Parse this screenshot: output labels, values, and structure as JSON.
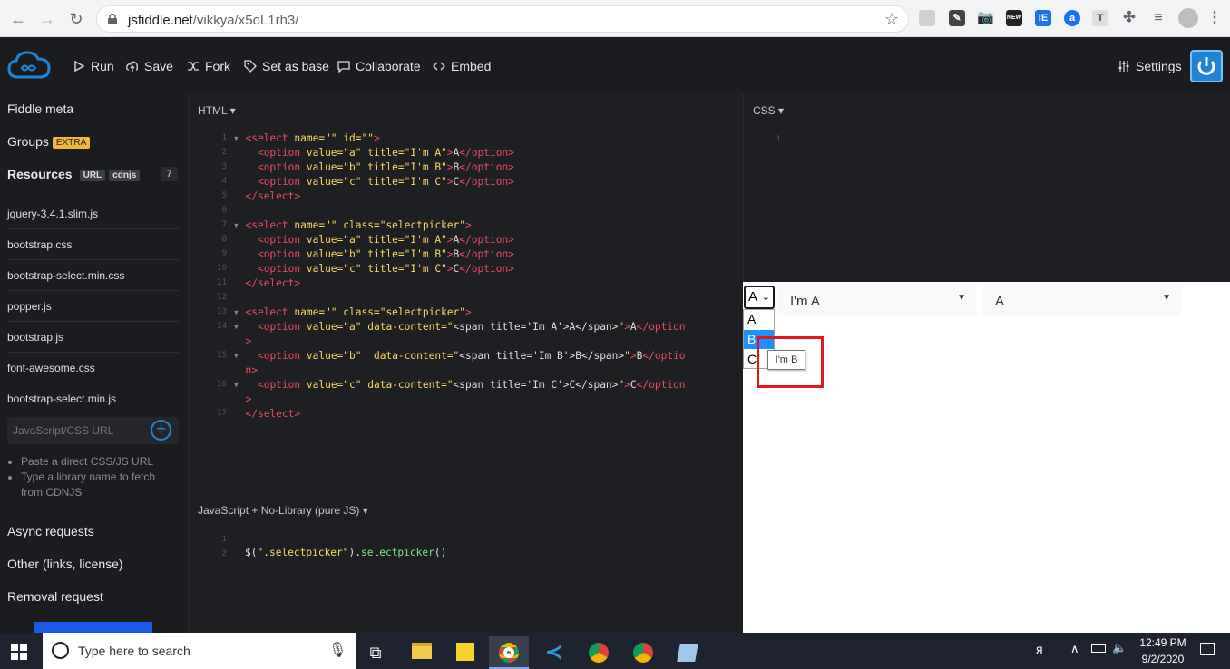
{
  "browser": {
    "url_host": "jsfiddle.net",
    "url_path": "/vikkya/x5oL1rh3/"
  },
  "header": {
    "run": "Run",
    "save": "Save",
    "fork": "Fork",
    "set_as_base": "Set as base",
    "collaborate": "Collaborate",
    "embed": "Embed",
    "settings": "Settings"
  },
  "sidebar": {
    "fiddle_meta": "Fiddle meta",
    "groups": "Groups",
    "groups_badge": "EXTRA",
    "resources": "Resources",
    "resources_url_tag": "URL",
    "resources_cdnjs_tag": "cdnjs",
    "resources_count": "7",
    "resources_list": [
      "jquery-3.4.1.slim.js",
      "bootstrap.css",
      "bootstrap-select.min.css",
      "popper.js",
      "bootstrap.js",
      "font-awesome.css",
      "bootstrap-select.min.js"
    ],
    "url_placeholder": "JavaScript/CSS URL",
    "hint1": "Paste a direct CSS/JS URL",
    "hint2": "Type a library name to fetch from CDNJS",
    "async": "Async requests",
    "other": "Other (links, license)",
    "removal": "Removal request"
  },
  "panels": {
    "html_label": "HTML",
    "css_label": "CSS",
    "js_label": "JavaScript + No-Library (pure JS)"
  },
  "html_lines": [
    "1",
    "2",
    "3",
    "4",
    "5",
    "6",
    "7",
    "8",
    "9",
    "10",
    "11",
    "12",
    "13",
    "14",
    "",
    "15",
    "",
    "16",
    "",
    "17"
  ],
  "css_lines": [
    "1"
  ],
  "js_lines": [
    "1",
    "2"
  ],
  "js_code": "$(\".selectpicker\").selectpicker()",
  "result": {
    "native_selected": "A",
    "options": [
      "A",
      "B",
      "C"
    ],
    "picker1_value": "I'm A",
    "picker2_value": "A",
    "tooltip": "I'm B"
  },
  "taskbar": {
    "search": "Type here to search",
    "time": "12:49 PM",
    "date": "9/2/2020"
  },
  "colors": {
    "accent": "#1f84d6",
    "red_box": "#e3161c"
  }
}
